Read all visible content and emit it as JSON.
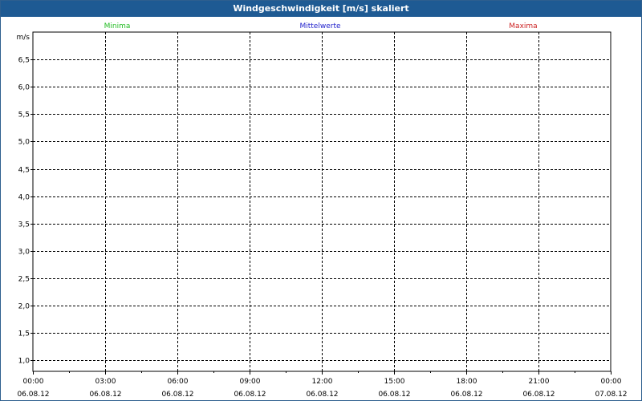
{
  "window": {
    "title": "Windgeschwindigkeit [m/s] skaliert"
  },
  "colors": {
    "title_bar": "#1e5a93",
    "grid": "#000000",
    "minima": "#22bb22",
    "mittelwerte": "#2222cc",
    "maxima": "#cc2222"
  },
  "chart_data": {
    "type": "line",
    "title": "Windgeschwindigkeit [m/s] skaliert",
    "ylabel": "m/s",
    "xlabel": "",
    "ylim": [
      0.8,
      7.0
    ],
    "y_ticks": [
      1.0,
      1.5,
      2.0,
      2.5,
      3.0,
      3.5,
      4.0,
      4.5,
      5.0,
      5.5,
      6.0,
      6.5
    ],
    "y_tick_labels": [
      "1,0",
      "1,5",
      "2,0",
      "2,5",
      "3,0",
      "3,5",
      "4,0",
      "4,5",
      "5,0",
      "5,5",
      "6,0",
      "6,5"
    ],
    "x_ticks": [
      {
        "time": "00:00",
        "date": "06.08.12"
      },
      {
        "time": "03:00",
        "date": "06.08.12"
      },
      {
        "time": "06:00",
        "date": "06.08.12"
      },
      {
        "time": "09:00",
        "date": "06.08.12"
      },
      {
        "time": "12:00",
        "date": "06.08.12"
      },
      {
        "time": "15:00",
        "date": "06.08.12"
      },
      {
        "time": "18:00",
        "date": "06.08.12"
      },
      {
        "time": "21:00",
        "date": "06.08.12"
      },
      {
        "time": "00:00",
        "date": "07.08.12"
      }
    ],
    "grid": true,
    "legend_placement": "top",
    "series": [
      {
        "name": "Minima",
        "values": []
      },
      {
        "name": "Mittelwerte",
        "values": []
      },
      {
        "name": "Maxima",
        "values": []
      }
    ]
  }
}
